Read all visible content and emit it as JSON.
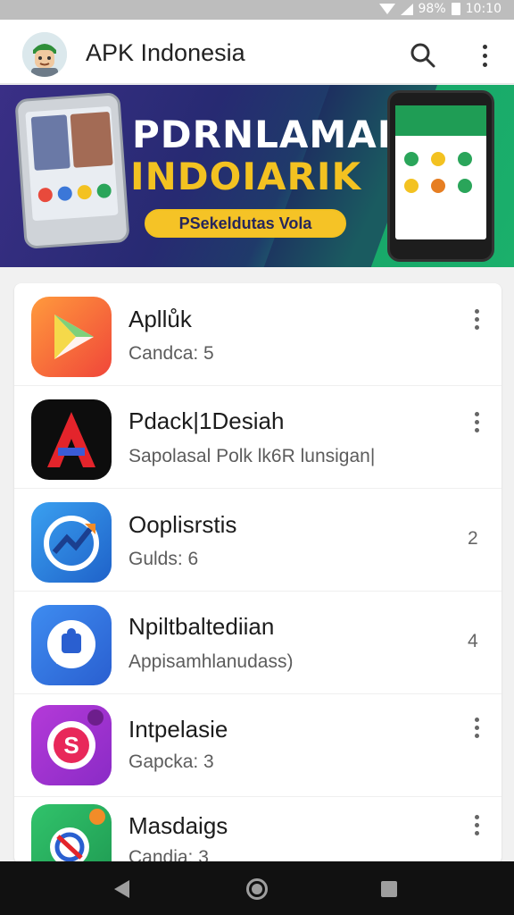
{
  "status_bar": {
    "battery_text": "98%",
    "time": "10:10"
  },
  "app_bar": {
    "title": "APK Indonesia",
    "icons": [
      "avatar",
      "search-icon",
      "more-vert-icon"
    ]
  },
  "banner": {
    "title_line1": "PDRNLAMAR",
    "title_line2": "INDOIARIK",
    "pill_text": "PSekeldutas Vola",
    "accent": "#f3c221",
    "bg_left": "#2b2b78",
    "bg_right": "#1bb06b"
  },
  "apps": [
    {
      "name": "Apllůk",
      "sub": "Candca: 5",
      "icon": "play-store-icon",
      "trail": "menu"
    },
    {
      "name": "Pdack|1Desiah",
      "sub": "Sapolasal Polk lk6R lunsigan|",
      "icon": "red-a-icon",
      "trail": "menu"
    },
    {
      "name": "Ooplisrstis",
      "sub": "Gulds: 6",
      "icon": "chat-arrow-icon",
      "trail": "2"
    },
    {
      "name": "Npiltbaltediian",
      "sub": "Appisamhlanudass)",
      "icon": "bubble-puzzle-icon",
      "trail": "4"
    },
    {
      "name": "Intpelasie",
      "sub": "Gapcka: 3",
      "icon": "s-bubble-icon",
      "trail": "menu"
    },
    {
      "name": "Masdaigs",
      "sub": "Candia: 3",
      "icon": "green-search-icon",
      "trail": "menu"
    }
  ]
}
